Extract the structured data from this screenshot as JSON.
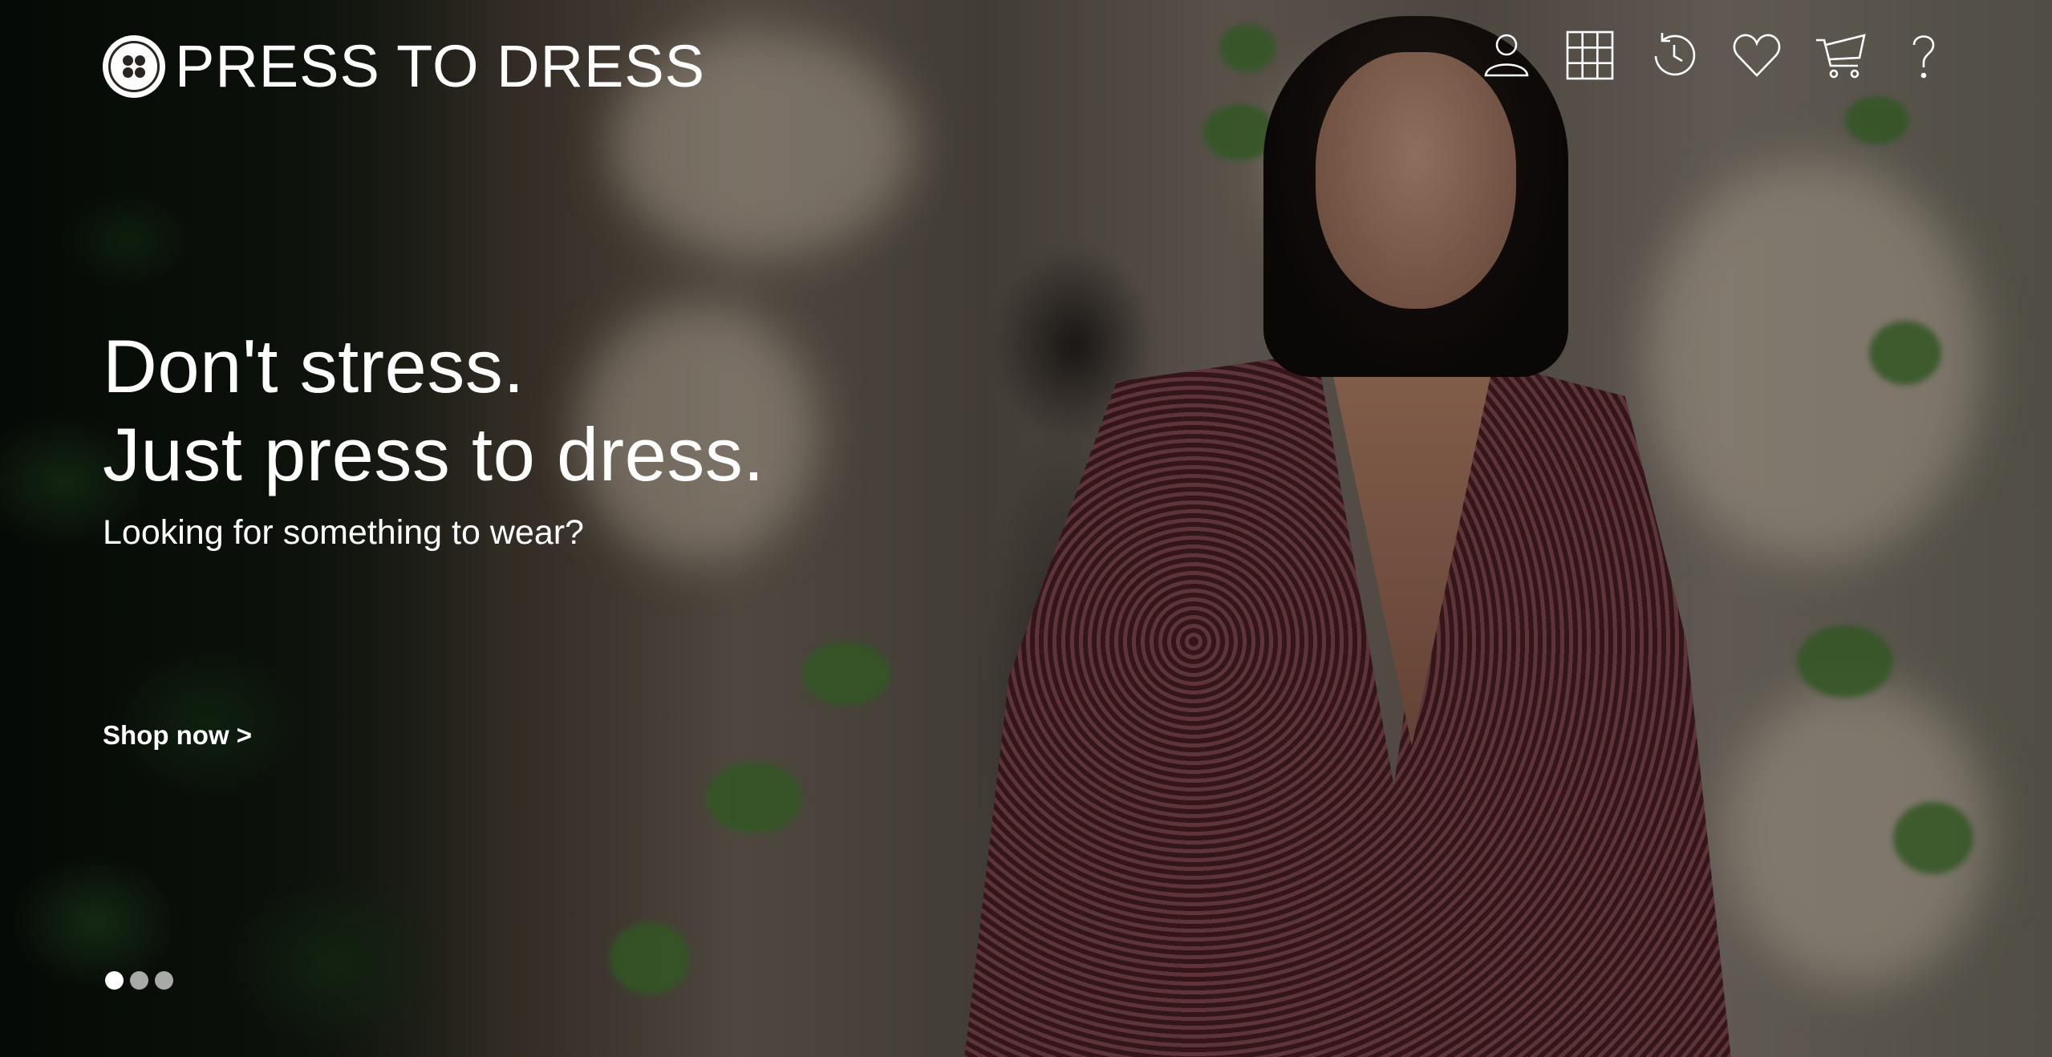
{
  "brand": {
    "name": "PRESS TO DRESS",
    "logo_icon": "button-icon"
  },
  "nav": {
    "icons": [
      {
        "name": "account-icon"
      },
      {
        "name": "catalog-grid-icon"
      },
      {
        "name": "history-icon"
      },
      {
        "name": "wishlist-heart-icon"
      },
      {
        "name": "cart-icon"
      },
      {
        "name": "help-icon"
      }
    ]
  },
  "hero": {
    "headline_line1": "Don't stress.",
    "headline_line2": "Just press to dress.",
    "subheadline": "Looking for something to wear?",
    "cta_label": "Shop now >"
  },
  "carousel": {
    "slide_count": 3,
    "active_index": 0
  },
  "colors": {
    "text": "#ffffff",
    "overlay": "#000000"
  }
}
